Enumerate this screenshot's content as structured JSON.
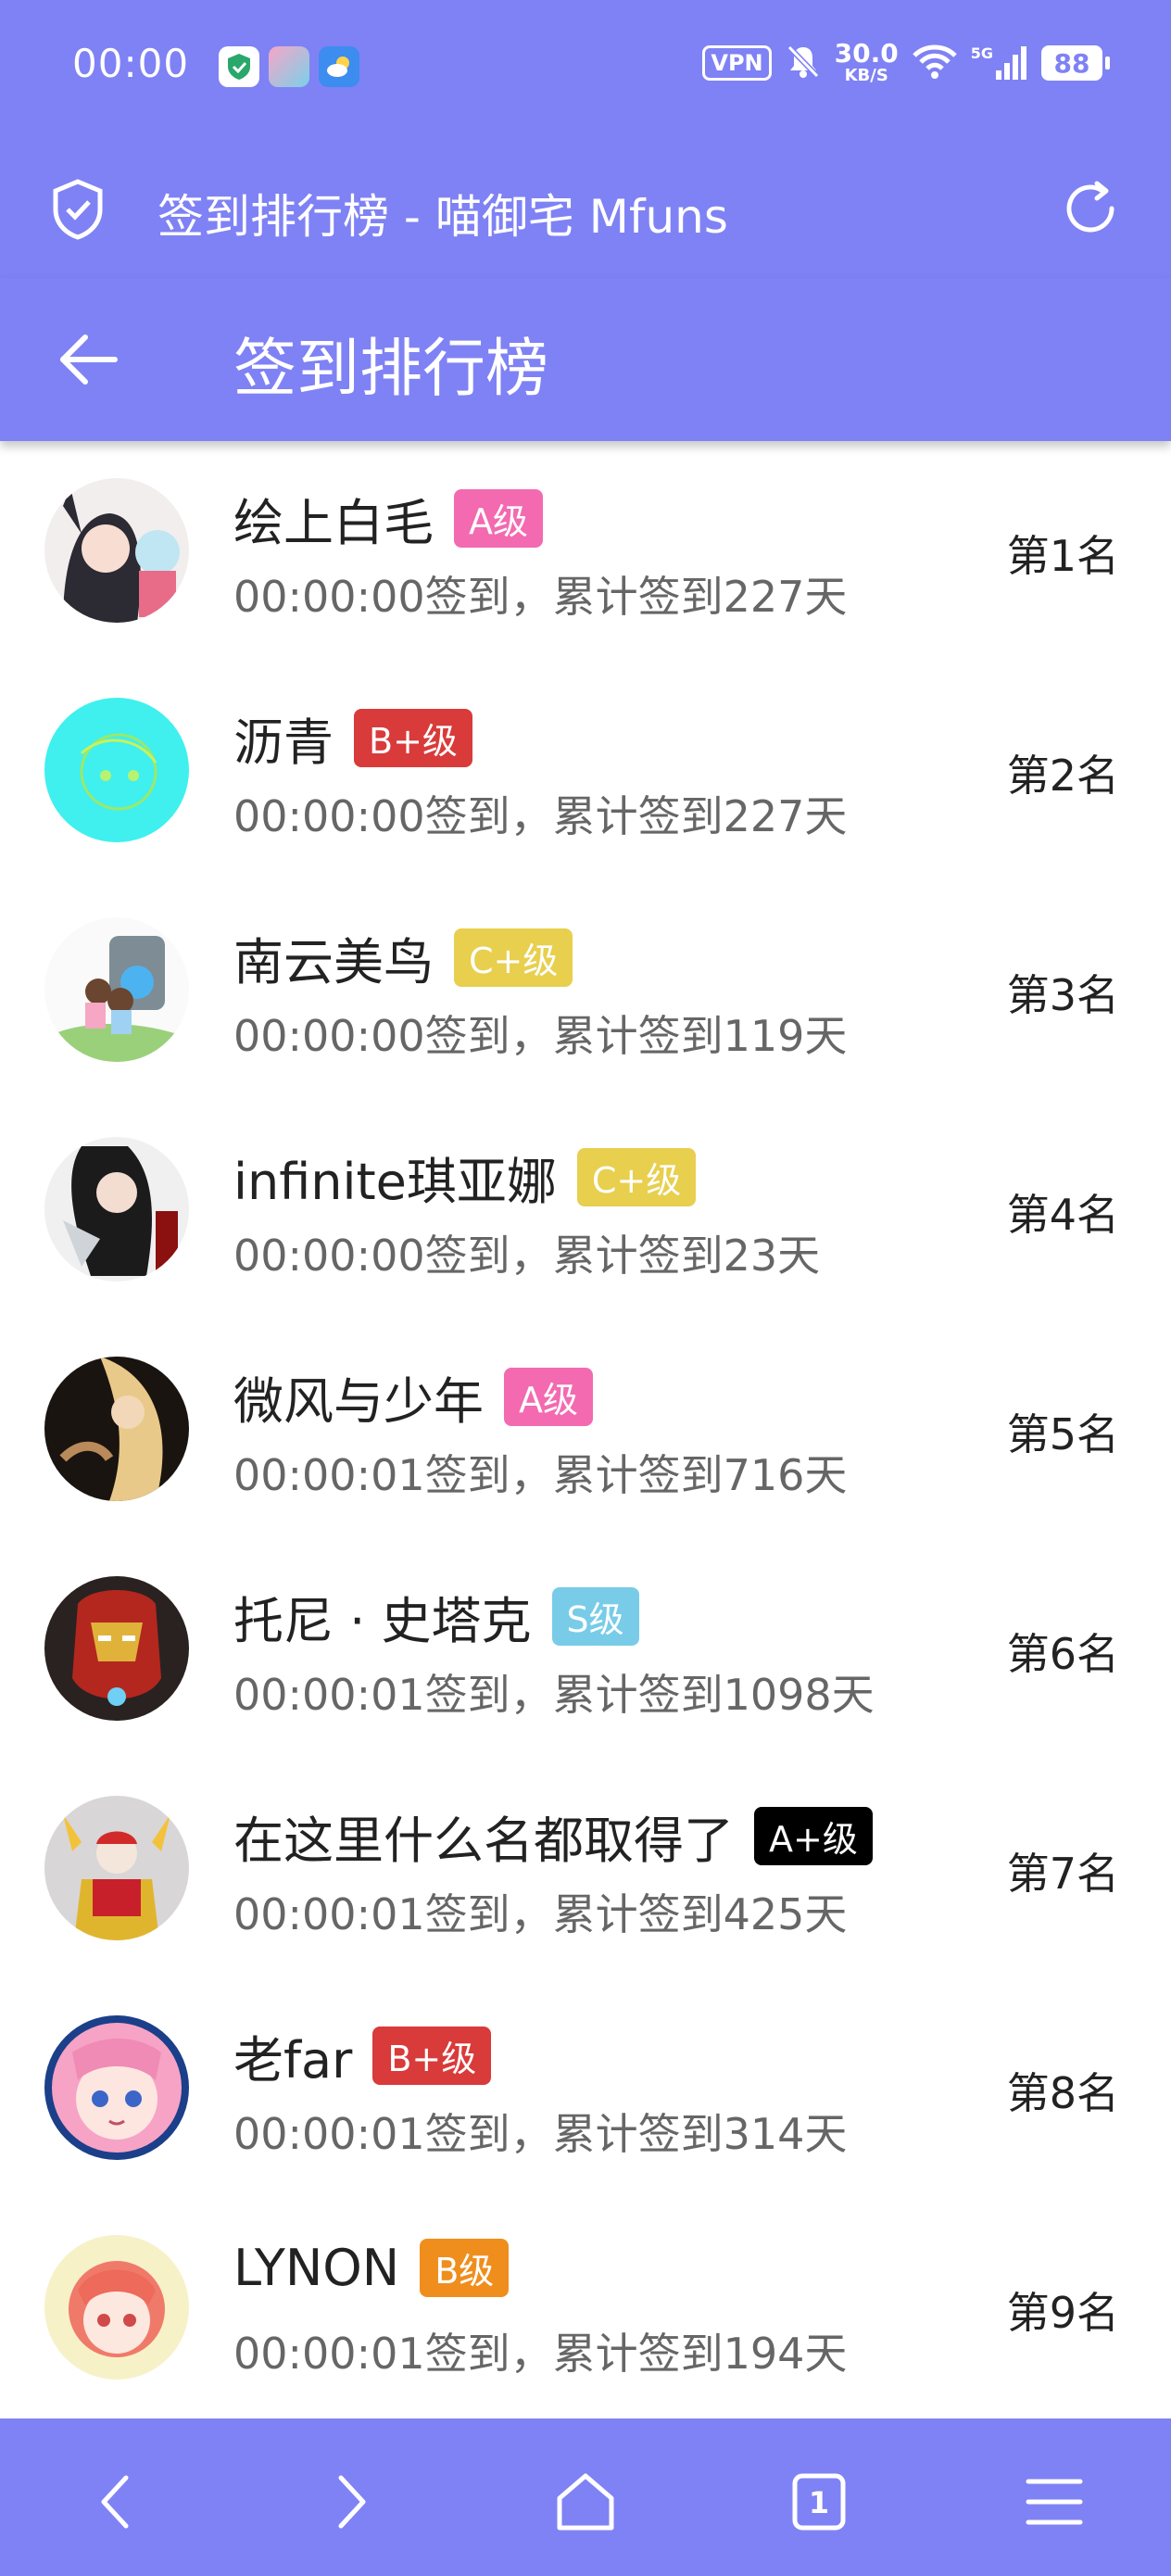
{
  "status": {
    "time": "00:00",
    "vpn": "VPN",
    "speed_value": "30.0",
    "speed_unit": "KB/S",
    "network": "5G",
    "battery": "88"
  },
  "browser": {
    "title": "签到排行榜 - 喵御宅 Mfuns"
  },
  "page": {
    "title": "签到排行榜"
  },
  "entries": [
    {
      "name": "绘上白毛",
      "badge": "A级",
      "badge_color": "#f36ab1",
      "meta": "00:00:00签到，累计签到227天",
      "rank": "第1名"
    },
    {
      "name": "沥青",
      "badge": "B+级",
      "badge_color": "#d93a3a",
      "meta": "00:00:00签到，累计签到227天",
      "rank": "第2名"
    },
    {
      "name": "南云美鸟",
      "badge": "C+级",
      "badge_color": "#e8cf4e",
      "meta": "00:00:00签到，累计签到119天",
      "rank": "第3名"
    },
    {
      "name": "infinite琪亚娜",
      "badge": "C+级",
      "badge_color": "#e8cf4e",
      "meta": "00:00:00签到，累计签到23天",
      "rank": "第4名"
    },
    {
      "name": "微风与少年",
      "badge": "A级",
      "badge_color": "#f36ab1",
      "meta": "00:00:01签到，累计签到716天",
      "rank": "第5名"
    },
    {
      "name": "托尼 · 史塔克",
      "badge": "S级",
      "badge_color": "#78cce8",
      "meta": "00:00:01签到，累计签到1098天",
      "rank": "第6名"
    },
    {
      "name": "在这里什么名都取得了",
      "badge": "A+级",
      "badge_color": "#000000",
      "meta": "00:00:01签到，累计签到425天",
      "rank": "第7名"
    },
    {
      "name": "老far",
      "badge": "B+级",
      "badge_color": "#d93a3a",
      "meta": "00:00:01签到，累计签到314天",
      "rank": "第8名"
    },
    {
      "name": "LYNON",
      "badge": "B级",
      "badge_color": "#ef8e1d",
      "meta": "00:00:01签到，累计签到194天",
      "rank": "第9名"
    }
  ],
  "bottom_nav": {
    "tab_count": "1"
  },
  "theme": {
    "accent": "#7f82f4"
  }
}
